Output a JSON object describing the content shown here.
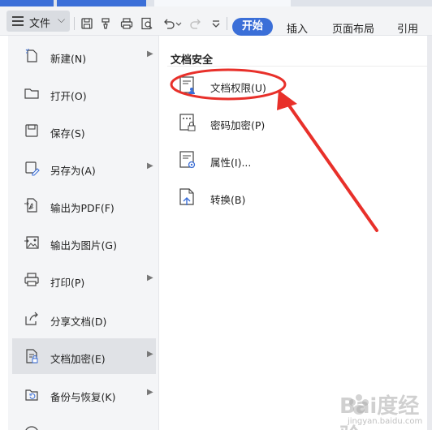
{
  "toolbar": {
    "menu_label": "文件",
    "icons": [
      "save-icon",
      "format-painter-icon",
      "print-icon",
      "print-preview-icon",
      "undo-icon",
      "redo-icon",
      "dropdown-icon"
    ],
    "tabs": [
      "开始",
      "插入",
      "页面布局",
      "引用"
    ],
    "active_tab": "开始"
  },
  "file_menu": {
    "items": [
      {
        "label": "新建(N)",
        "icon": "new-file-icon",
        "submenu": true
      },
      {
        "label": "打开(O)",
        "icon": "open-folder-icon",
        "submenu": false
      },
      {
        "label": "保存(S)",
        "icon": "save-icon",
        "submenu": false
      },
      {
        "label": "另存为(A)",
        "icon": "save-as-icon",
        "submenu": true
      },
      {
        "label": "输出为PDF(F)",
        "icon": "export-pdf-icon",
        "submenu": false
      },
      {
        "label": "输出为图片(G)",
        "icon": "export-image-icon",
        "submenu": false
      },
      {
        "label": "打印(P)",
        "icon": "print-icon",
        "submenu": true
      },
      {
        "label": "分享文档(D)",
        "icon": "share-icon",
        "submenu": false
      },
      {
        "label": "文档加密(E)",
        "icon": "encrypt-document-icon",
        "submenu": true,
        "active": true
      },
      {
        "label": "备份与恢复(K)",
        "icon": "backup-restore-icon",
        "submenu": true
      }
    ]
  },
  "submenu": {
    "title": "文档安全",
    "items": [
      {
        "label": "文档权限(U)",
        "icon": "document-permission-icon"
      },
      {
        "label": "密码加密(P)",
        "icon": "password-encrypt-icon"
      },
      {
        "label": "属性(I)...",
        "icon": "properties-icon"
      },
      {
        "label": "转换(B)",
        "icon": "convert-icon"
      }
    ]
  },
  "annotation": {
    "color": "#e8302a"
  },
  "watermark": {
    "text": "Bai度经验",
    "sub": "jingyan.baidu.com"
  }
}
